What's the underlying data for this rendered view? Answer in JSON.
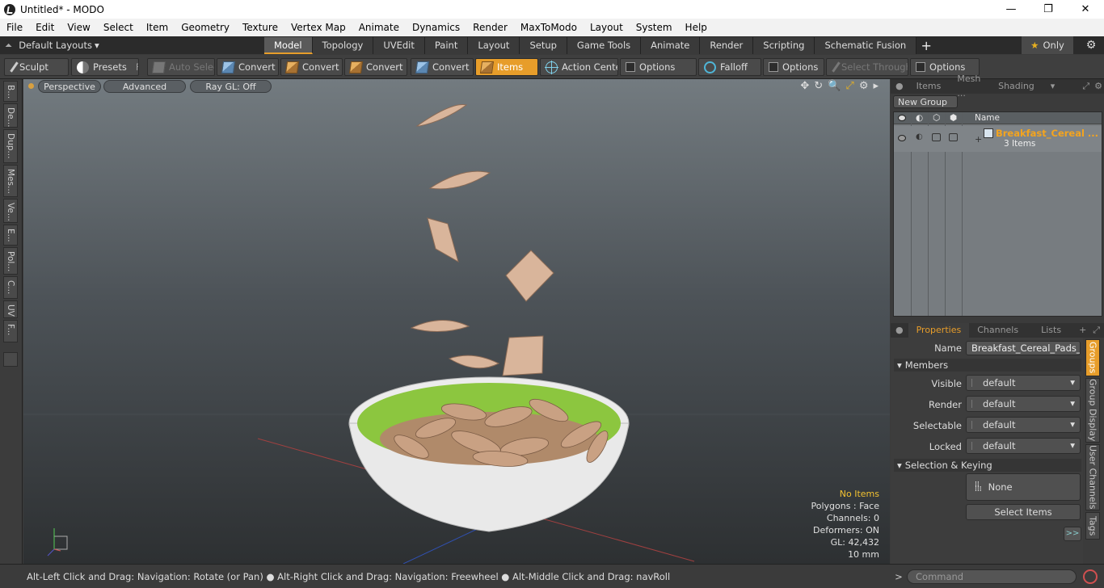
{
  "window": {
    "title": "Untitled* - MODO",
    "minimize": "—",
    "maximize": "❐",
    "close": "✕"
  },
  "menu": [
    "File",
    "Edit",
    "View",
    "Select",
    "Item",
    "Geometry",
    "Texture",
    "Vertex Map",
    "Animate",
    "Dynamics",
    "Render",
    "MaxToModo",
    "Layout",
    "System",
    "Help"
  ],
  "layout": {
    "dropdown_label": "Default Layouts",
    "plus": "+",
    "only_label": "Only",
    "gear": "⚙"
  },
  "layout_tabs": [
    "Model",
    "Topology",
    "UVEdit",
    "Paint",
    "Layout",
    "Setup",
    "Game Tools",
    "Animate",
    "Render",
    "Scripting",
    "Schematic Fusion"
  ],
  "active_layout_tab": "Model",
  "toolbar": {
    "sculpt": "Sculpt",
    "presets": "Presets",
    "presets_key": "F6",
    "auto_select": "Auto Select",
    "convert1": "Convert",
    "convert2": "Convert",
    "convert3": "Convert",
    "convert4": "Convert",
    "items": "Items",
    "action_center": "Action Center",
    "options1": "Options",
    "falloff": "Falloff",
    "options2": "Options",
    "select_through": "Select Through",
    "options3": "Options"
  },
  "left_tabs": [
    "B...",
    "De...",
    "Dup...",
    "Mes...",
    "Ve...",
    "E...",
    "Pol...",
    "C...",
    "UV",
    "F..."
  ],
  "viewport": {
    "perspective": "Perspective",
    "advanced": "Advanced",
    "raygl": "Ray GL: Off",
    "icons": [
      "✥",
      "↻",
      "🔍",
      "⤢",
      "⚙",
      "▸"
    ]
  },
  "stats": {
    "no_items": "No Items",
    "polygons": "Polygons : Face",
    "channels": "Channels: 0",
    "deformers": "Deformers: ON",
    "gl": "GL: 42,432",
    "scale": "10 mm"
  },
  "statusbar": {
    "message": "Alt-Left Click and Drag: Navigation: Rotate (or Pan) ● Alt-Right Click and Drag: Navigation: Freewheel ● Alt-Middle Click and Drag: navRoll",
    "prompt": ">",
    "command_placeholder": "Command"
  },
  "items_panel": {
    "tabs": [
      "Items",
      "Mesh ...",
      "Shading"
    ],
    "new_group": "New Group",
    "name_header": "Name",
    "item_name": "Breakfast_Cereal ...",
    "item_count": "3 Items"
  },
  "properties_panel": {
    "tabs": [
      "Properties",
      "Channels",
      "Lists"
    ],
    "name_label": "Name",
    "name_value": "Breakfast_Cereal_Pads_Fal",
    "members_section": "Members",
    "visible_label": "Visible",
    "visible_value": "default",
    "render_label": "Render",
    "render_value": "default",
    "selectable_label": "Selectable",
    "selectable_value": "default",
    "locked_label": "Locked",
    "locked_value": "default",
    "selection_section": "Selection & Keying",
    "none_button": "None",
    "select_items_button": "Select Items",
    "more_button": ">>",
    "side_tabs": [
      "Groups",
      "Group Display",
      "User Channels",
      "Tags"
    ]
  }
}
